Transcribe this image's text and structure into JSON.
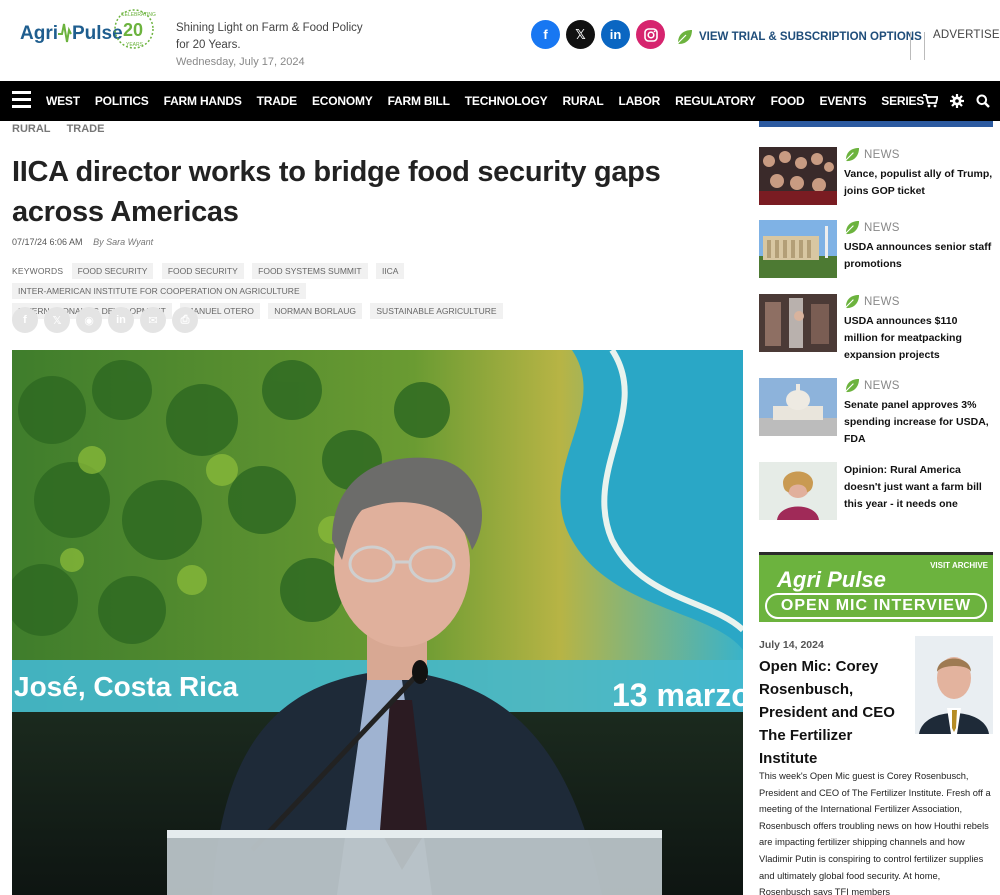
{
  "brand": {
    "logo_text_a": "Agri",
    "logo_text_b": "Pulse",
    "logo_badge_number": "20",
    "logo_badge_top": "CELEBRATING",
    "logo_badge_bottom": "YEARS",
    "tagline_line1": "Shining Light on Farm & Food Policy",
    "tagline_line2": "for 20 Years.",
    "date": "Wednesday, July 17, 2024",
    "green": "#6cb33e",
    "blue": "#1f4d7a"
  },
  "social": [
    {
      "name": "facebook-icon",
      "glyph": "f"
    },
    {
      "name": "x-icon",
      "glyph": "𝕏"
    },
    {
      "name": "linkedin-icon",
      "glyph": "in"
    },
    {
      "name": "instagram-icon",
      "glyph": "◘"
    }
  ],
  "header": {
    "trial_label": "VIEW TRIAL & SUBSCRIPTION OPTIONS",
    "advertise_label": "ADVERTISE"
  },
  "nav": {
    "items": [
      "WEST",
      "POLITICS",
      "FARM HANDS",
      "TRADE",
      "ECONOMY",
      "FARM BILL",
      "TECHNOLOGY",
      "RURAL",
      "LABOR",
      "REGULATORY",
      "FOOD",
      "EVENTS",
      "SERIES"
    ]
  },
  "article": {
    "crumbs": [
      "RURAL",
      "TRADE"
    ],
    "title": "IICA director works to bridge food security gaps across Americas",
    "date": "07/17/24 6:06 AM",
    "byline": "By Sara Wyant",
    "keywords_label": "KEYWORDS",
    "keywords": [
      "FOOD SECURITY",
      "FOOD SECURITY",
      "FOOD SYSTEMS SUMMIT",
      "IICA",
      "INTER-AMERICAN INSTITUTE FOR COOPERATION ON AGRICULTURE",
      "INTERNATIONAL AG DEVELOPMENT",
      "MANUEL OTERO",
      "NORMAN BORLAUG",
      "SUSTAINABLE AGRICULTURE"
    ],
    "share": [
      "f",
      "𝕏",
      "◉",
      "in",
      "✉",
      "⎙"
    ],
    "hero_caption_left": "José, Costa Rica",
    "hero_caption_right": "13 marzo"
  },
  "sidebar": {
    "news_tag": "NEWS",
    "items": [
      {
        "headline": "Vance, populist ally of Trump, joins GOP ticket",
        "tagged": true
      },
      {
        "headline": "USDA announces senior staff promotions",
        "tagged": true
      },
      {
        "headline": "USDA announces $110 million for meatpacking expansion projects",
        "tagged": true
      },
      {
        "headline": "Senate panel approves 3% spending increase for USDA, FDA",
        "tagged": true
      },
      {
        "headline": "Opinion: Rural America doesn't just want a farm bill this year - it needs one",
        "tagged": false
      }
    ],
    "banner": {
      "visit": "VISIT ARCHIVE",
      "line1": "Agri Pulse",
      "line2": "OPEN MIC INTERVIEW"
    },
    "open_mic": {
      "date": "July 14, 2024",
      "title": "Open Mic: Corey Rosenbusch, President and CEO The Fertilizer Institute",
      "body": "This week's Open Mic guest is Corey Rosenbusch, President and CEO of The Fertilizer Institute. Fresh off a meeting of the International Fertilizer Association, Rosenbusch offers troubling news on how Houthi rebels are impacting fertilizer shipping channels and how Vladimir Putin is conspiring to control fertilizer supplies and ultimately global food security. At home, Rosenbusch says TFI members"
    }
  }
}
